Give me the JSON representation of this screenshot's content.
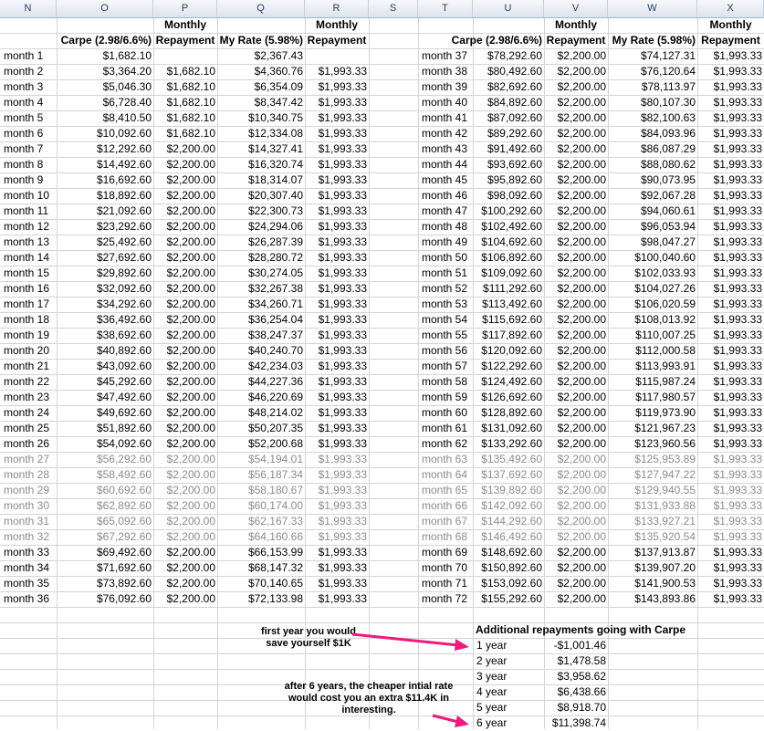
{
  "columns": {
    "n": "N",
    "o": "O",
    "p": "P",
    "q": "Q",
    "r": "R",
    "s": "S",
    "t": "T",
    "u": "U",
    "v": "V",
    "w": "W",
    "x": "X"
  },
  "headers": {
    "monthly": "Monthly",
    "carpe": "Carpe (2.98/6.6%)",
    "repayment": "Repayment",
    "my_rate": "My Rate (5.98%)"
  },
  "left_rows": [
    {
      "m": "month 1",
      "o": "$1,682.10",
      "p": "",
      "q": "$2,367.43",
      "r": ""
    },
    {
      "m": "month 2",
      "o": "$3,364.20",
      "p": "$1,682.10",
      "q": "$4,360.76",
      "r": "$1,993.33"
    },
    {
      "m": "month 3",
      "o": "$5,046.30",
      "p": "$1,682.10",
      "q": "$6,354.09",
      "r": "$1,993.33"
    },
    {
      "m": "month 4",
      "o": "$6,728.40",
      "p": "$1,682.10",
      "q": "$8,347.42",
      "r": "$1,993.33"
    },
    {
      "m": "month 5",
      "o": "$8,410.50",
      "p": "$1,682.10",
      "q": "$10,340.75",
      "r": "$1,993.33"
    },
    {
      "m": "month 6",
      "o": "$10,092.60",
      "p": "$1,682.10",
      "q": "$12,334.08",
      "r": "$1,993.33"
    },
    {
      "m": "month 7",
      "o": "$12,292.60",
      "p": "$2,200.00",
      "q": "$14,327.41",
      "r": "$1,993.33"
    },
    {
      "m": "month 8",
      "o": "$14,492.60",
      "p": "$2,200.00",
      "q": "$16,320.74",
      "r": "$1,993.33"
    },
    {
      "m": "month 9",
      "o": "$16,692.60",
      "p": "$2,200.00",
      "q": "$18,314.07",
      "r": "$1,993.33"
    },
    {
      "m": "month 10",
      "o": "$18,892.60",
      "p": "$2,200.00",
      "q": "$20,307.40",
      "r": "$1,993.33"
    },
    {
      "m": "month 11",
      "o": "$21,092.60",
      "p": "$2,200.00",
      "q": "$22,300.73",
      "r": "$1,993.33"
    },
    {
      "m": "month 12",
      "o": "$23,292.60",
      "p": "$2,200.00",
      "q": "$24,294.06",
      "r": "$1,993.33"
    },
    {
      "m": "month 13",
      "o": "$25,492.60",
      "p": "$2,200.00",
      "q": "$26,287.39",
      "r": "$1,993.33"
    },
    {
      "m": "month 14",
      "o": "$27,692.60",
      "p": "$2,200.00",
      "q": "$28,280.72",
      "r": "$1,993.33"
    },
    {
      "m": "month 15",
      "o": "$29,892.60",
      "p": "$2,200.00",
      "q": "$30,274.05",
      "r": "$1,993.33"
    },
    {
      "m": "month 16",
      "o": "$32,092.60",
      "p": "$2,200.00",
      "q": "$32,267.38",
      "r": "$1,993.33"
    },
    {
      "m": "month 17",
      "o": "$34,292.60",
      "p": "$2,200.00",
      "q": "$34,260.71",
      "r": "$1,993.33"
    },
    {
      "m": "month 18",
      "o": "$36,492.60",
      "p": "$2,200.00",
      "q": "$36,254.04",
      "r": "$1,993.33"
    },
    {
      "m": "month 19",
      "o": "$38,692.60",
      "p": "$2,200.00",
      "q": "$38,247.37",
      "r": "$1,993.33"
    },
    {
      "m": "month 20",
      "o": "$40,892.60",
      "p": "$2,200.00",
      "q": "$40,240.70",
      "r": "$1,993.33"
    },
    {
      "m": "month 21",
      "o": "$43,092.60",
      "p": "$2,200.00",
      "q": "$42,234.03",
      "r": "$1,993.33"
    },
    {
      "m": "month 22",
      "o": "$45,292.60",
      "p": "$2,200.00",
      "q": "$44,227.36",
      "r": "$1,993.33"
    },
    {
      "m": "month 23",
      "o": "$47,492.60",
      "p": "$2,200.00",
      "q": "$46,220.69",
      "r": "$1,993.33"
    },
    {
      "m": "month 24",
      "o": "$49,692.60",
      "p": "$2,200.00",
      "q": "$48,214.02",
      "r": "$1,993.33"
    },
    {
      "m": "month 25",
      "o": "$51,892.60",
      "p": "$2,200.00",
      "q": "$50,207.35",
      "r": "$1,993.33"
    },
    {
      "m": "month 26",
      "o": "$54,092.60",
      "p": "$2,200.00",
      "q": "$52,200.68",
      "r": "$1,993.33"
    },
    {
      "m": "month 27",
      "o": "$56,292.60",
      "p": "$2,200.00",
      "q": "$54,194.01",
      "r": "$1,993.33"
    },
    {
      "m": "month 28",
      "o": "$58,492.60",
      "p": "$2,200.00",
      "q": "$56,187.34",
      "r": "$1,993.33"
    },
    {
      "m": "month 29",
      "o": "$60,692.60",
      "p": "$2,200.00",
      "q": "$58,180.67",
      "r": "$1,993.33"
    },
    {
      "m": "month 30",
      "o": "$62,892.60",
      "p": "$2,200.00",
      "q": "$60,174.00",
      "r": "$1,993.33"
    },
    {
      "m": "month 31",
      "o": "$65,092.60",
      "p": "$2,200.00",
      "q": "$62,167.33",
      "r": "$1,993.33"
    },
    {
      "m": "month 32",
      "o": "$67,292.60",
      "p": "$2,200.00",
      "q": "$64,160.66",
      "r": "$1,993.33"
    },
    {
      "m": "month 33",
      "o": "$69,492.60",
      "p": "$2,200.00",
      "q": "$66,153.99",
      "r": "$1,993.33"
    },
    {
      "m": "month 34",
      "o": "$71,692.60",
      "p": "$2,200.00",
      "q": "$68,147.32",
      "r": "$1,993.33"
    },
    {
      "m": "month 35",
      "o": "$73,892.60",
      "p": "$2,200.00",
      "q": "$70,140.65",
      "r": "$1,993.33"
    },
    {
      "m": "month 36",
      "o": "$76,092.60",
      "p": "$2,200.00",
      "q": "$72,133.98",
      "r": "$1,993.33"
    }
  ],
  "right_rows": [
    {
      "m": "month 37",
      "u": "$78,292.60",
      "v": "$2,200.00",
      "w": "$74,127.31",
      "x": "$1,993.33"
    },
    {
      "m": "month 38",
      "u": "$80,492.60",
      "v": "$2,200.00",
      "w": "$76,120.64",
      "x": "$1,993.33"
    },
    {
      "m": "month 39",
      "u": "$82,692.60",
      "v": "$2,200.00",
      "w": "$78,113.97",
      "x": "$1,993.33"
    },
    {
      "m": "month 40",
      "u": "$84,892.60",
      "v": "$2,200.00",
      "w": "$80,107.30",
      "x": "$1,993.33"
    },
    {
      "m": "month 41",
      "u": "$87,092.60",
      "v": "$2,200.00",
      "w": "$82,100.63",
      "x": "$1,993.33"
    },
    {
      "m": "month 42",
      "u": "$89,292.60",
      "v": "$2,200.00",
      "w": "$84,093.96",
      "x": "$1,993.33"
    },
    {
      "m": "month 43",
      "u": "$91,492.60",
      "v": "$2,200.00",
      "w": "$86,087.29",
      "x": "$1,993.33"
    },
    {
      "m": "month 44",
      "u": "$93,692.60",
      "v": "$2,200.00",
      "w": "$88,080.62",
      "x": "$1,993.33"
    },
    {
      "m": "month 45",
      "u": "$95,892.60",
      "v": "$2,200.00",
      "w": "$90,073.95",
      "x": "$1,993.33"
    },
    {
      "m": "month 46",
      "u": "$98,092.60",
      "v": "$2,200.00",
      "w": "$92,067.28",
      "x": "$1,993.33"
    },
    {
      "m": "month 47",
      "u": "$100,292.60",
      "v": "$2,200.00",
      "w": "$94,060.61",
      "x": "$1,993.33"
    },
    {
      "m": "month 48",
      "u": "$102,492.60",
      "v": "$2,200.00",
      "w": "$96,053.94",
      "x": "$1,993.33"
    },
    {
      "m": "month 49",
      "u": "$104,692.60",
      "v": "$2,200.00",
      "w": "$98,047.27",
      "x": "$1,993.33"
    },
    {
      "m": "month 50",
      "u": "$106,892.60",
      "v": "$2,200.00",
      "w": "$100,040.60",
      "x": "$1,993.33"
    },
    {
      "m": "month 51",
      "u": "$109,092.60",
      "v": "$2,200.00",
      "w": "$102,033.93",
      "x": "$1,993.33"
    },
    {
      "m": "month 52",
      "u": "$111,292.60",
      "v": "$2,200.00",
      "w": "$104,027.26",
      "x": "$1,993.33"
    },
    {
      "m": "month 53",
      "u": "$113,492.60",
      "v": "$2,200.00",
      "w": "$106,020.59",
      "x": "$1,993.33"
    },
    {
      "m": "month 54",
      "u": "$115,692.60",
      "v": "$2,200.00",
      "w": "$108,013.92",
      "x": "$1,993.33"
    },
    {
      "m": "month 55",
      "u": "$117,892.60",
      "v": "$2,200.00",
      "w": "$110,007.25",
      "x": "$1,993.33"
    },
    {
      "m": "month 56",
      "u": "$120,092.60",
      "v": "$2,200.00",
      "w": "$112,000.58",
      "x": "$1,993.33"
    },
    {
      "m": "month 57",
      "u": "$122,292.60",
      "v": "$2,200.00",
      "w": "$113,993.91",
      "x": "$1,993.33"
    },
    {
      "m": "month 58",
      "u": "$124,492.60",
      "v": "$2,200.00",
      "w": "$115,987.24",
      "x": "$1,993.33"
    },
    {
      "m": "month 59",
      "u": "$126,692.60",
      "v": "$2,200.00",
      "w": "$117,980.57",
      "x": "$1,993.33"
    },
    {
      "m": "month 60",
      "u": "$128,892.60",
      "v": "$2,200.00",
      "w": "$119,973.90",
      "x": "$1,993.33"
    },
    {
      "m": "month 61",
      "u": "$131,092.60",
      "v": "$2,200.00",
      "w": "$121,967.23",
      "x": "$1,993.33"
    },
    {
      "m": "month 62",
      "u": "$133,292.60",
      "v": "$2,200.00",
      "w": "$123,960.56",
      "x": "$1,993.33"
    },
    {
      "m": "month 63",
      "u": "$135,492.60",
      "v": "$2,200.00",
      "w": "$125,953.89",
      "x": "$1,993.33"
    },
    {
      "m": "month 64",
      "u": "$137,692.60",
      "v": "$2,200.00",
      "w": "$127,947.22",
      "x": "$1,993.33"
    },
    {
      "m": "month 65",
      "u": "$139,892.60",
      "v": "$2,200.00",
      "w": "$129,940.55",
      "x": "$1,993.33"
    },
    {
      "m": "month 66",
      "u": "$142,092.60",
      "v": "$2,200.00",
      "w": "$131,933.88",
      "x": "$1,993.33"
    },
    {
      "m": "month 67",
      "u": "$144,292.60",
      "v": "$2,200.00",
      "w": "$133,927.21",
      "x": "$1,993.33"
    },
    {
      "m": "month 68",
      "u": "$146,492.60",
      "v": "$2,200.00",
      "w": "$135,920.54",
      "x": "$1,993.33"
    },
    {
      "m": "month 69",
      "u": "$148,692.60",
      "v": "$2,200.00",
      "w": "$137,913.87",
      "x": "$1,993.33"
    },
    {
      "m": "month 70",
      "u": "$150,892.60",
      "v": "$2,200.00",
      "w": "$139,907.20",
      "x": "$1,993.33"
    },
    {
      "m": "month 71",
      "u": "$153,092.60",
      "v": "$2,200.00",
      "w": "$141,900.53",
      "x": "$1,993.33"
    },
    {
      "m": "month 72",
      "u": "$155,292.60",
      "v": "$2,200.00",
      "w": "$143,893.86",
      "x": "$1,993.33"
    }
  ],
  "summary": {
    "title": "Additional repayments going with Carpe",
    "rows": [
      {
        "label": "1 year",
        "value": "-$1,001.46"
      },
      {
        "label": "2 year",
        "value": "$1,478.58"
      },
      {
        "label": "3 year",
        "value": "$3,958.62"
      },
      {
        "label": "4 year",
        "value": "$6,438.66"
      },
      {
        "label": "5 year",
        "value": "$8,918.70"
      },
      {
        "label": "6 year",
        "value": "$11,398.74"
      }
    ]
  },
  "notes": {
    "first_line1": "first year you would",
    "first_line2": "save yourself $1K",
    "second_line1": "after 6 years, the cheaper intial rate",
    "second_line2": "would cost you an extra $11.4K in",
    "second_line3": "interesting."
  },
  "colors": {
    "arrow": "#f0197d",
    "faded_text": "#8c8c8c",
    "header_bg": "#dde3ec",
    "gridline": "#d4d4d4"
  }
}
